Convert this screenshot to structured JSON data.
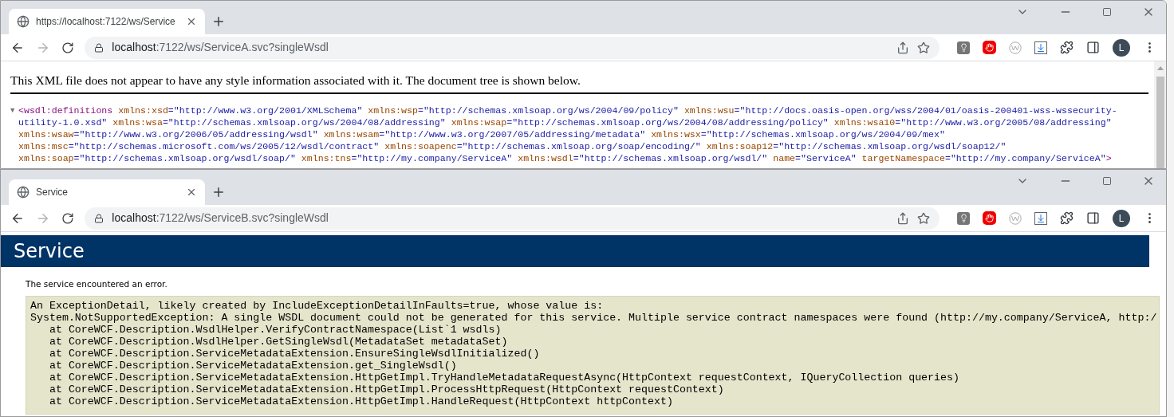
{
  "windows": [
    {
      "kind": "xml",
      "tab": {
        "title": "https://localhost:7122/ws/Service"
      },
      "address": {
        "host": "localhost",
        "path": ":7122/ws/ServiceA.svc?singleWsdl"
      },
      "avatar": "L",
      "content": {
        "notice": "This XML file does not appear to have any style information associated with it. The document tree is shown below.",
        "toggle": "▼",
        "lines": [
          [
            {
              "kind": "tag",
              "text": "<wsdl:definitions"
            },
            {
              "kind": "attr",
              "text": " xmlns:xsd"
            },
            {
              "kind": "value",
              "text": "=\"http://www.w3.org/2001/XMLSchema\""
            },
            {
              "kind": "attr",
              "text": " xmlns:wsp"
            },
            {
              "kind": "value",
              "text": "=\"http://schemas.xmlsoap.org/ws/2004/09/policy\""
            },
            {
              "kind": "attr",
              "text": " xmlns:wsu"
            },
            {
              "kind": "value",
              "text": "=\"http://docs.oasis-open.org/wss/2004/01/oasis-200401-wss-wssecurity-"
            }
          ],
          [
            {
              "kind": "value",
              "text": "utility-1.0.xsd\""
            },
            {
              "kind": "attr",
              "text": " xmlns:wsa"
            },
            {
              "kind": "value",
              "text": "=\"http://schemas.xmlsoap.org/ws/2004/08/addressing\""
            },
            {
              "kind": "attr",
              "text": " xmlns:wsap"
            },
            {
              "kind": "value",
              "text": "=\"http://schemas.xmlsoap.org/ws/2004/08/addressing/policy\""
            },
            {
              "kind": "attr",
              "text": " xmlns:wsa10"
            },
            {
              "kind": "value",
              "text": "=\"http://www.w3.org/2005/08/addressing\""
            }
          ],
          [
            {
              "kind": "attr",
              "text": "xmlns:wsaw"
            },
            {
              "kind": "value",
              "text": "=\"http://www.w3.org/2006/05/addressing/wsdl\""
            },
            {
              "kind": "attr",
              "text": " xmlns:wsam"
            },
            {
              "kind": "value",
              "text": "=\"http://www.w3.org/2007/05/addressing/metadata\""
            },
            {
              "kind": "attr",
              "text": " xmlns:wsx"
            },
            {
              "kind": "value",
              "text": "=\"http://schemas.xmlsoap.org/ws/2004/09/mex\""
            }
          ],
          [
            {
              "kind": "attr",
              "text": "xmlns:msc"
            },
            {
              "kind": "value",
              "text": "=\"http://schemas.microsoft.com/ws/2005/12/wsdl/contract\""
            },
            {
              "kind": "attr",
              "text": " xmlns:soapenc"
            },
            {
              "kind": "value",
              "text": "=\"http://schemas.xmlsoap.org/soap/encoding/\""
            },
            {
              "kind": "attr",
              "text": " xmlns:soap12"
            },
            {
              "kind": "value",
              "text": "=\"http://schemas.xmlsoap.org/wsdl/soap12/\""
            }
          ],
          [
            {
              "kind": "attr",
              "text": "xmlns:soap"
            },
            {
              "kind": "value",
              "text": "=\"http://schemas.xmlsoap.org/wsdl/soap/\""
            },
            {
              "kind": "attr",
              "text": " xmlns:tns"
            },
            {
              "kind": "value",
              "text": "=\"http://my.company/ServiceA\""
            },
            {
              "kind": "attr",
              "text": " xmlns:wsdl"
            },
            {
              "kind": "value",
              "text": "=\"http://schemas.xmlsoap.org/wsdl/\""
            },
            {
              "kind": "attr",
              "text": " name"
            },
            {
              "kind": "value",
              "text": "=\"ServiceA\""
            },
            {
              "kind": "attr",
              "text": " targetNamespace"
            },
            {
              "kind": "value",
              "text": "=\"http://my.company/ServiceA\""
            },
            {
              "kind": "tag",
              "text": ">"
            }
          ]
        ]
      }
    },
    {
      "kind": "service",
      "tab": {
        "title": "Service"
      },
      "address": {
        "host": "localhost",
        "path": ":7122/ws/ServiceB.svc?singleWsdl"
      },
      "avatar": "L",
      "content": {
        "heading": "Service",
        "message": "The service encountered an error.",
        "details": [
          "An ExceptionDetail, likely created by IncludeExceptionDetailInFaults=true, whose value is:",
          "System.NotSupportedException: A single WSDL document could not be generated for this service. Multiple service contract namespaces were found (http://my.company/ServiceA, http:/",
          "   at CoreWCF.Description.WsdlHelper.VerifyContractNamespace(List`1 wsdls)",
          "   at CoreWCF.Description.WsdlHelper.GetSingleWsdl(MetadataSet metadataSet)",
          "   at CoreWCF.Description.ServiceMetadataExtension.EnsureSingleWsdlInitialized()",
          "   at CoreWCF.Description.ServiceMetadataExtension.get_SingleWsdl()",
          "   at CoreWCF.Description.ServiceMetadataExtension.HttpGetImpl.TryHandleMetadataRequestAsync(HttpContext requestContext, IQueryCollection queries)",
          "   at CoreWCF.Description.ServiceMetadataExtension.HttpGetImpl.ProcessHttpRequest(HttpContext requestContext)",
          "   at CoreWCF.Description.ServiceMetadataExtension.HttpGetImpl.HandleRequest(HttpContext httpContext)"
        ]
      }
    }
  ]
}
